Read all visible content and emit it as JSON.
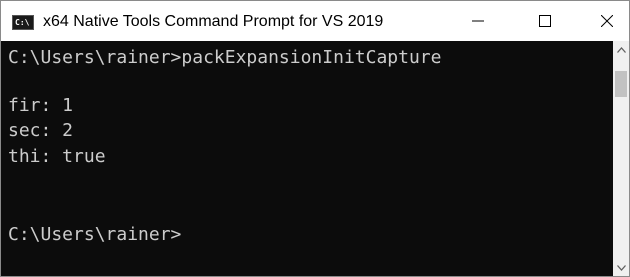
{
  "window": {
    "title": "x64 Native Tools Command Prompt for VS 2019",
    "icon_name": "cmd-app-icon",
    "icon_text": "C:\\"
  },
  "controls": {
    "minimize_icon": "minimize-icon",
    "maximize_icon": "maximize-icon",
    "close_icon": "close-icon"
  },
  "console": {
    "lines": [
      "C:\\Users\\rainer>packExpansionInitCapture",
      "",
      "fir: 1",
      "sec: 2",
      "thi: true",
      "",
      "",
      "C:\\Users\\rainer>"
    ],
    "text_color": "#cccccc",
    "background_color": "#0c0c0c"
  },
  "scrollbar": {
    "up_icon": "scroll-up-arrow-icon",
    "down_icon": "scroll-down-arrow-icon"
  }
}
